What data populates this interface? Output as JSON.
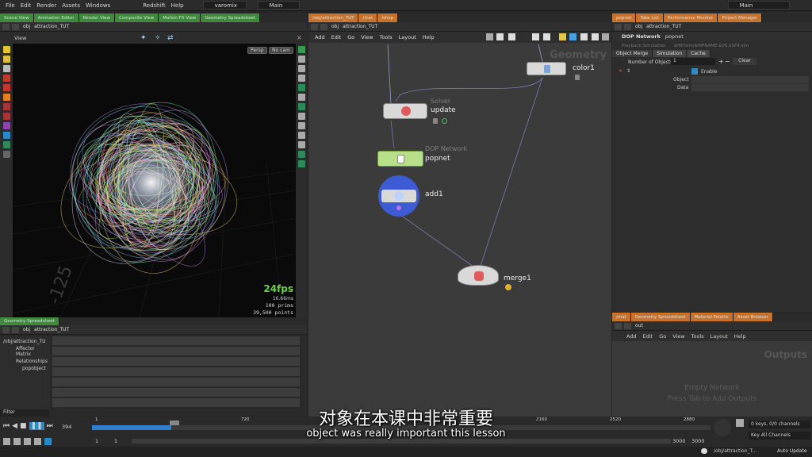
{
  "menubar": {
    "items": [
      "File",
      "Edit",
      "Render",
      "Assets",
      "Windows"
    ],
    "items_right": [
      "Redshift",
      "Help"
    ],
    "desktop": "varomix",
    "main_desk": "Main",
    "main_desk_right": "Main"
  },
  "left_tabs": [
    "Scene View",
    "Animation Editor",
    "Render View",
    "Composite View",
    "Motion FX View",
    "Geometry Spreadsheet"
  ],
  "left_path": {
    "obj": "obj",
    "node": "attraction_TUT"
  },
  "viewport": {
    "label": "View",
    "persp": "Persp",
    "cam": "No cam",
    "fps": "24fps",
    "ms": "16.66ms",
    "prims_num": "100",
    "prims_label": "prims",
    "points_num": "39,500",
    "points_label": "points",
    "grid_label": "-125"
  },
  "net_tabs": [
    "/obj/attraction_TUT",
    "/mat",
    "/shop"
  ],
  "net_path": {
    "obj": "obj",
    "node": "attraction_TUT"
  },
  "net_menus": [
    "Add",
    "Edit",
    "Go",
    "View",
    "Tools",
    "Layout",
    "Help"
  ],
  "net_context": "Geometry",
  "nodes": {
    "color": {
      "name": "color1"
    },
    "solver": {
      "type": "Solver",
      "name": "update"
    },
    "dop": {
      "type": "DOP Network",
      "name": "popnet"
    },
    "add": {
      "name": "add1"
    },
    "merge": {
      "name": "merge1"
    }
  },
  "param_tabs": [
    "popnet",
    "Take List",
    "Performance Monitor",
    "Project Manager"
  ],
  "param_path": {
    "obj": "obj",
    "node": "attraction_TUT"
  },
  "param": {
    "node_type": "DOP Network",
    "node_name": "popnet",
    "playback": "Playback Simulation",
    "file_path": "$HIP/sim/$HIPNAME.$OS.$SF4.sim",
    "tabs": [
      "Object Merge",
      "Simulation",
      "Cache"
    ],
    "num_objects_label": "Number of Objects",
    "num_objects_value": "1",
    "clear_label": "Clear",
    "enable_label": "Enable",
    "object_label": "Object",
    "data_label": "Data"
  },
  "br_tabs": [
    "/mat",
    "Geometry Spreadsheet",
    "Material Palette",
    "Asset Browser"
  ],
  "br_path": "out",
  "br_menus": [
    "Add",
    "Edit",
    "Go",
    "View",
    "Tools",
    "Layout",
    "Help"
  ],
  "br_context": "Outputs",
  "br_empty_1": "Empty Network",
  "br_empty_2": "Press Tab to Add Outputs",
  "spreadsheet": {
    "tab": "Geometry Spreadsheet",
    "path": {
      "obj": "obj",
      "node": "attraction_TUT"
    },
    "tree": [
      "/obj/attraction_TU",
      "Affector Matrix",
      "Relationships",
      "popobject"
    ],
    "filter": "Filter"
  },
  "timeline": {
    "frame": "394",
    "start": "1",
    "start2": "1",
    "ticks": [
      "1",
      "720",
      "1440",
      "2160",
      "2520",
      "2880"
    ],
    "end": "3000",
    "end2": "3000",
    "keys": "0 keys, 0/0 channels",
    "key_all": "Key All Channels",
    "status_path": "/obj/attraction_T...",
    "auto_update": "Auto Update"
  },
  "subtitle_cn": "对象在本课中非常重要",
  "subtitle_en": "object was really important this lesson"
}
